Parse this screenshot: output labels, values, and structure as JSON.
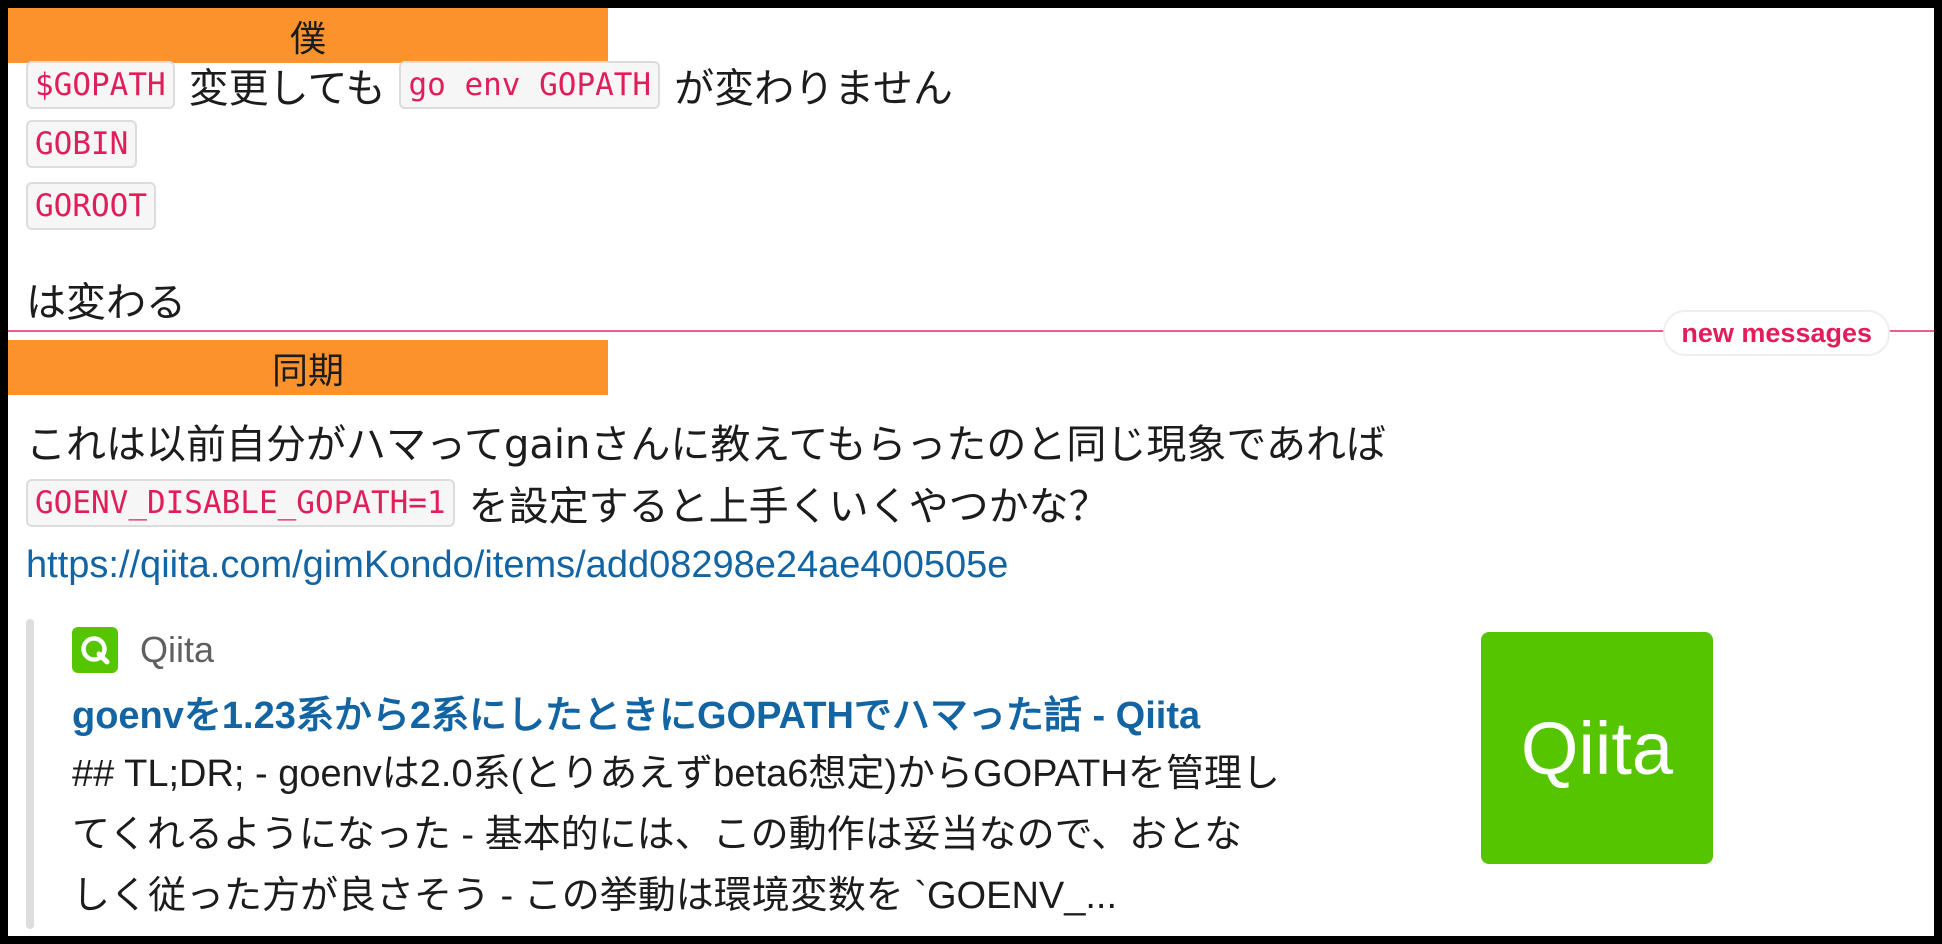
{
  "messages": [
    {
      "sender": "僕",
      "line1": {
        "code1": "$GOPATH",
        "text1": "変更しても",
        "code2": "go env GOPATH",
        "text2": "が変わりません"
      },
      "code_gobin": "GOBIN",
      "code_goroot": "GOROOT",
      "line_end": "は変わる"
    },
    {
      "sender": "同期",
      "line1": "これは以前自分がハマってgainさんに教えてもらったのと同じ現象であれば",
      "line2": {
        "code": "GOENV_DISABLE_GOPATH=1",
        "text": "を設定すると上手くいくやつかな？"
      },
      "link": "https://qiita.com/gimKondo/items/add08298e24ae400505e"
    }
  ],
  "divider": {
    "label": "new messages"
  },
  "unfurl": {
    "service_name": "Qiita",
    "service_icon": "qiita-q-icon",
    "title": "goenvを1.23系から2系にしたときにGOPATHでハマった話 - Qiita",
    "description_lines": [
      "## TL;DR; - goenvは2.0系(とりあえずbeta6想定)からGOPATHを管理し",
      "てくれるようになった - 基本的には、この動作は妥当なので、おとな",
      "しく従った方が良さそう - この挙動は環境変数を `GOENV_..."
    ],
    "thumbnail_text": "Qiita"
  },
  "colors": {
    "sender_bg": "#fb922c",
    "code_text": "#e01e5a",
    "link": "#1264a3",
    "divider": "#ec5f8b",
    "qiita_green": "#55c500"
  }
}
